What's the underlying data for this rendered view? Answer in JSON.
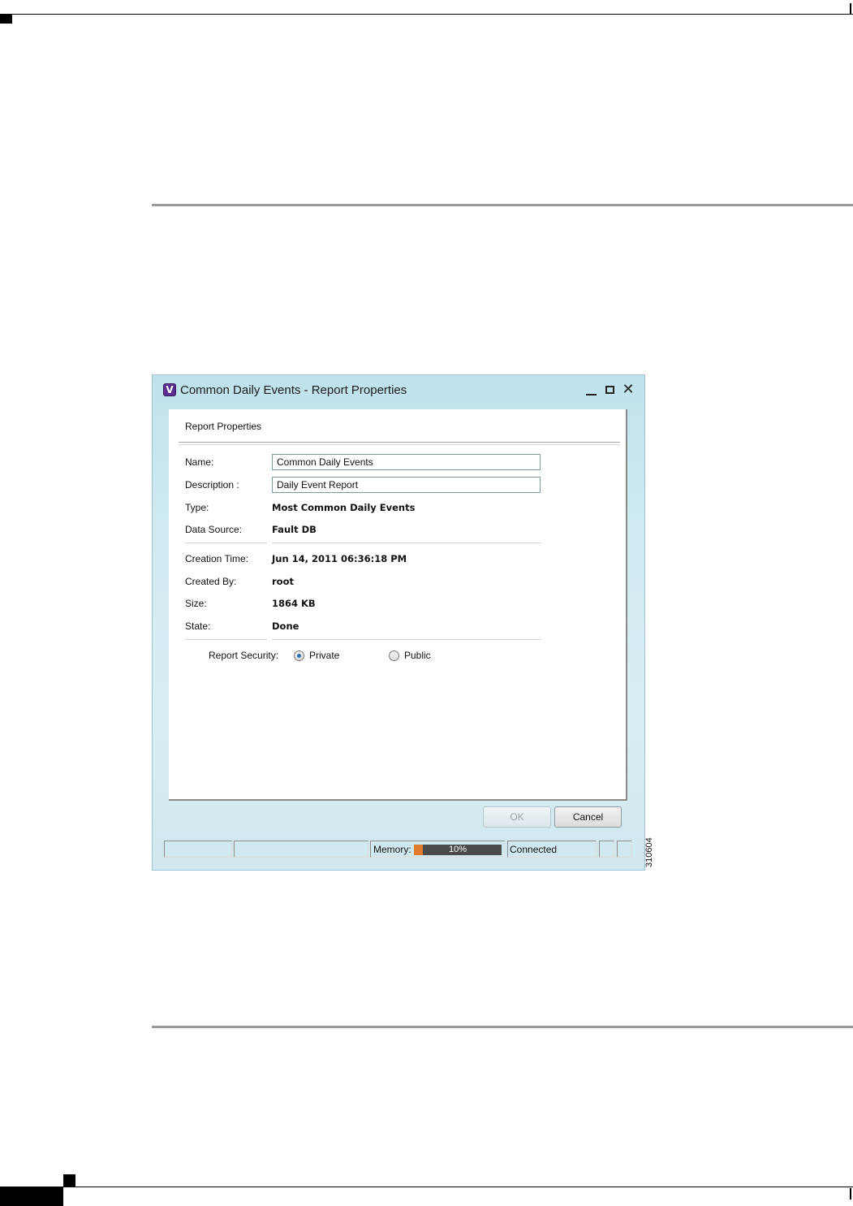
{
  "window": {
    "icon_letter": "V",
    "title": "Common Daily Events - Report Properties",
    "controls": {
      "minimize": "minimize-icon",
      "maximize": "maximize-icon",
      "close": "close-icon"
    }
  },
  "panel": {
    "title": "Report Properties",
    "fields": {
      "name_label": "Name:",
      "name_value": "Common Daily Events",
      "description_label": "Description :",
      "description_value": "Daily Event Report",
      "type_label": "Type:",
      "type_value": "Most Common Daily Events",
      "data_source_label": "Data Source:",
      "data_source_value": "Fault DB",
      "creation_time_label": "Creation Time:",
      "creation_time_value": "Jun 14, 2011 06:36:18 PM",
      "created_by_label": "Created By:",
      "created_by_value": "root",
      "size_label": "Size:",
      "size_value": "1864 KB",
      "state_label": "State:",
      "state_value": "Done"
    },
    "security": {
      "label": "Report Security:",
      "options": [
        "Private",
        "Public"
      ],
      "selected": "Private"
    }
  },
  "buttons": {
    "ok": "OK",
    "cancel": "Cancel"
  },
  "statusbar": {
    "memory_label": "Memory:",
    "memory_percent_text": "10%",
    "memory_fraction": 0.1,
    "connection": "Connected",
    "memory_fill_color": "#e07a2c",
    "memory_track_color": "#4a4a4a"
  },
  "figure_number": "310604"
}
